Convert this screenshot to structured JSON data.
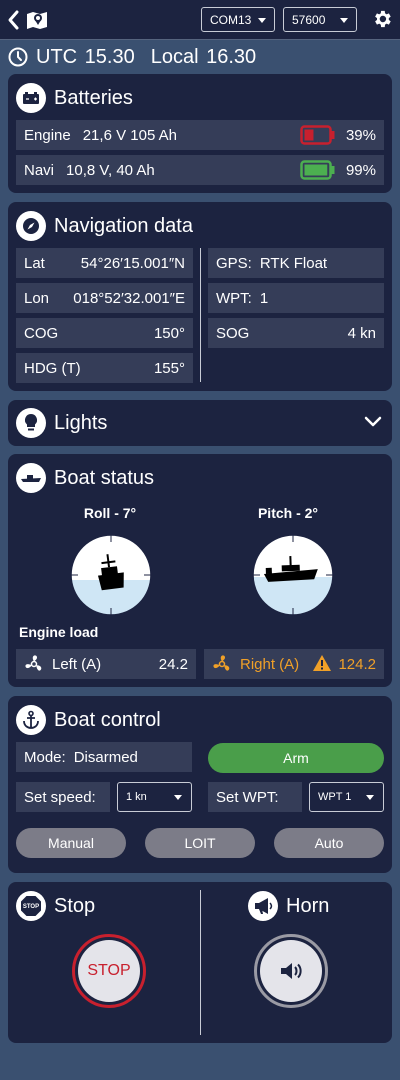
{
  "header": {
    "port": "COM13",
    "baud": "57600",
    "icons": [
      "chevron-left-icon",
      "map-pin-icon",
      "gear-icon"
    ]
  },
  "time": {
    "utc": "UTC 15.30",
    "local": "Local 16.30"
  },
  "batteries": {
    "title": "Batteries",
    "rows": [
      {
        "name": "Engine",
        "info": "21,6 V 105 Ah",
        "percent": "39%",
        "level": 0.39,
        "color": "#c8202e"
      },
      {
        "name": "Navi",
        "info": "10,8 V, 40 Ah",
        "percent": "99%",
        "level": 0.99,
        "color": "#4caf50"
      }
    ]
  },
  "navigation": {
    "title": "Navigation data",
    "lat_label": "Lat",
    "lat": "54°26′15.001″N",
    "lon_label": "Lon",
    "lon": "018°52′32.001″E",
    "cog_label": "COG",
    "cog": "150°",
    "hdg_label": "HDG (T)",
    "hdg": "155°",
    "gps_label": "GPS:",
    "gps": "RTK Float",
    "wpt_label": "WPT:",
    "wpt": "1",
    "sog_label": "SOG",
    "sog": "4 kn"
  },
  "lights": {
    "title": "Lights"
  },
  "boat_status": {
    "title": "Boat status",
    "roll": "Roll - 7°",
    "pitch": "Pitch - 2°",
    "engine_load_label": "Engine load",
    "left_label": "Left (A)",
    "left_value": "24.2",
    "right_label": "Right (A)",
    "right_value": "124.2",
    "warning_color": "#f0a028"
  },
  "boat_control": {
    "title": "Boat control",
    "mode_label": "Mode:",
    "mode": "Disarmed",
    "arm_label": "Arm",
    "speed_label": "Set speed:",
    "speed_value": "1 kn",
    "wpt_label": "Set WPT:",
    "wpt_value": "WPT 1",
    "buttons": [
      "Manual",
      "LOIT",
      "Auto"
    ],
    "arm_color": "#4a9e4a"
  },
  "stop": {
    "title": "Stop",
    "button_label": "STOP",
    "color": "#c8202e",
    "icon_text": "STOP"
  },
  "horn": {
    "title": "Horn"
  }
}
